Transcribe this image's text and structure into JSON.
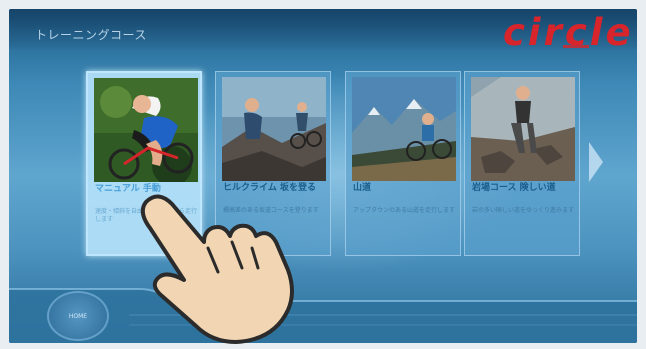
{
  "header": {
    "title": "トレーニングコース",
    "brand": "circle"
  },
  "courses": [
    {
      "title": "マニュアル 手動",
      "description": "速度・傾斜を自由に調整しながら走行します",
      "selected": true
    },
    {
      "title": "ヒルクライム 坂を登る",
      "description": "標高差のある坂道コースを登ります",
      "selected": false
    },
    {
      "title": "山道",
      "description": "アップダウンのある山道を走行します",
      "selected": false
    },
    {
      "title": "岩場コース 険しい道",
      "description": "岩の多い険しい道をゆっくり進みます",
      "selected": false
    }
  ],
  "footer": {
    "home_label": "HOME"
  },
  "colors": {
    "brand": "#d8242b",
    "screen_bg": "#4c93bf",
    "card_selected": "#b4e1fa"
  },
  "icons": {
    "next": "chevron-right-icon",
    "pointer": "hand-pointer-icon"
  }
}
